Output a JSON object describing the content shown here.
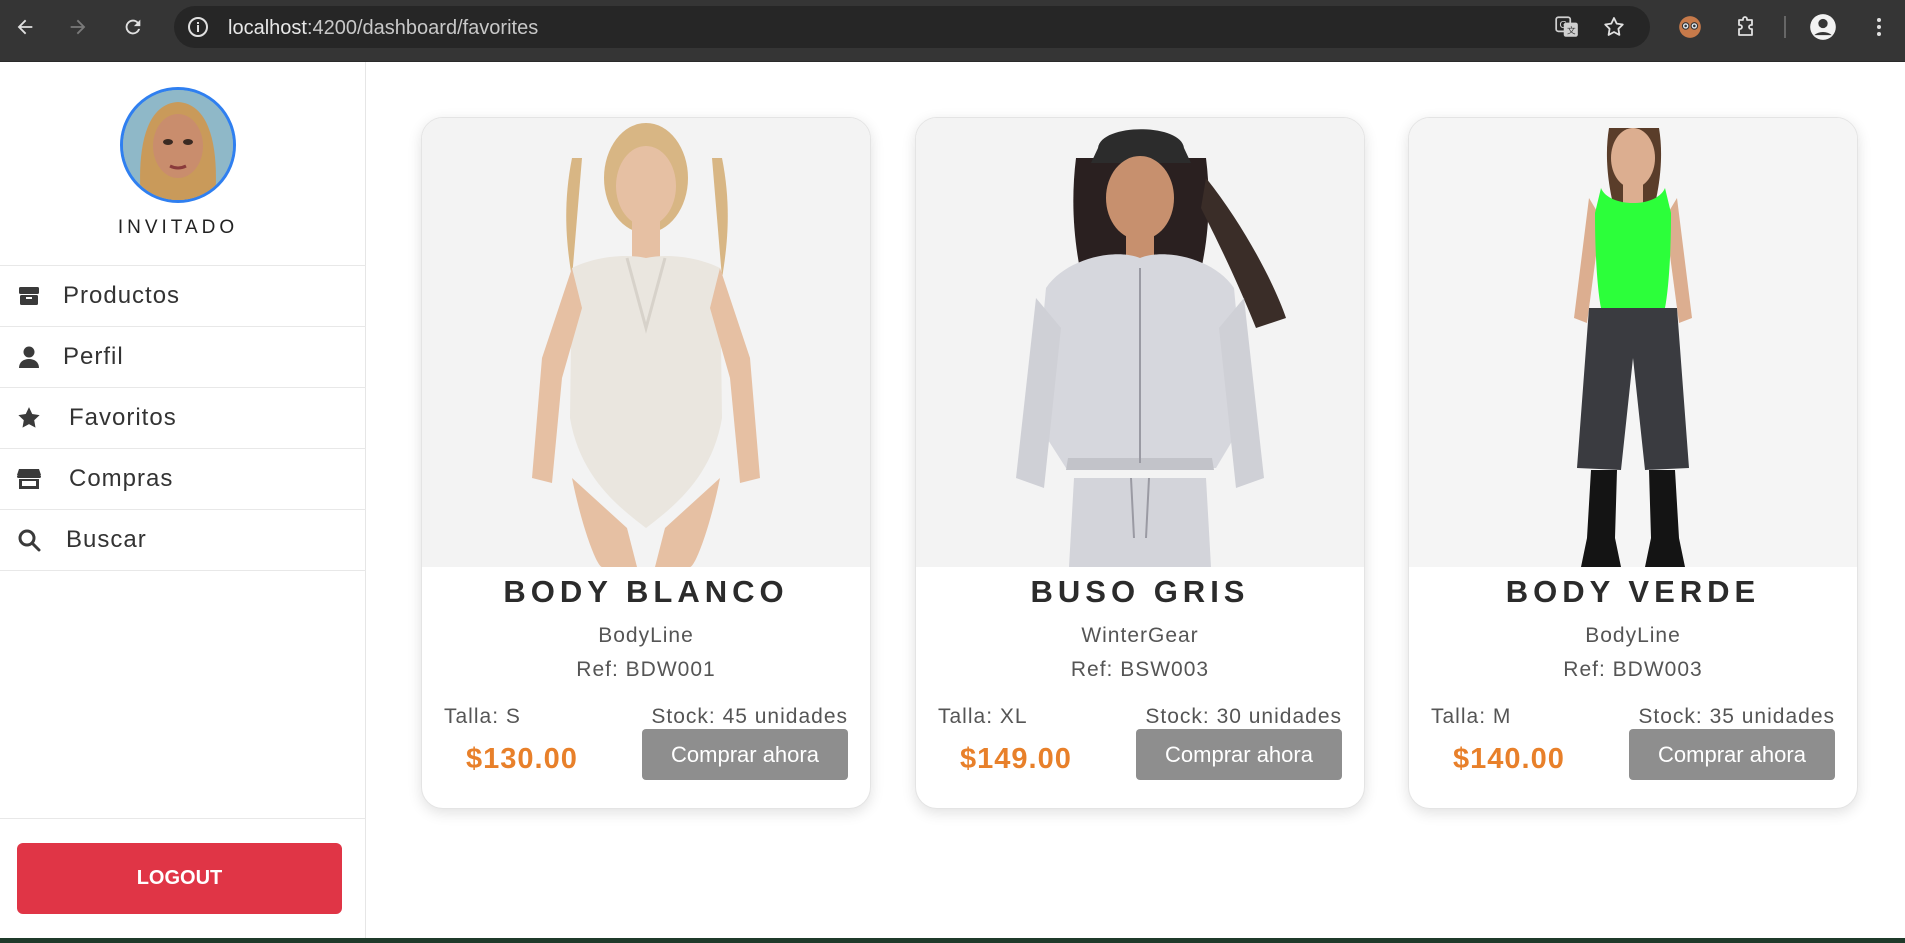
{
  "browser": {
    "url_host": "localhost",
    "url_path": ":4200/dashboard/favorites",
    "icons": [
      "back-arrow-icon",
      "forward-arrow-icon",
      "reload-icon",
      "site-info-icon",
      "translate-icon",
      "bookmark-star-icon",
      "extension-avatar-icon",
      "extensions-puzzle-icon",
      "profile-icon",
      "more-menu-icon"
    ]
  },
  "sidebar": {
    "username": "INVITADO",
    "items": [
      {
        "label": "Productos",
        "icon": "box-icon"
      },
      {
        "label": "Perfil",
        "icon": "user-icon"
      },
      {
        "label": "Favoritos",
        "icon": "star-icon"
      },
      {
        "label": "Compras",
        "icon": "store-icon"
      },
      {
        "label": "Buscar",
        "icon": "search-icon"
      }
    ],
    "logout_label": "LOGOUT"
  },
  "colors": {
    "accent_price": "#e8802a",
    "logout": "#e03546",
    "avatar_ring": "#2f7ff0",
    "buy_button": "#8e8e8e"
  },
  "products": [
    {
      "name": "BODY BLANCO",
      "brand": "BodyLine",
      "ref": "Ref: BDW001",
      "talla": "Talla: S",
      "stock": "Stock: 45 unidades",
      "price": "$130.00",
      "buy_label": "Comprar ahora"
    },
    {
      "name": "BUSO GRIS",
      "brand": "WinterGear",
      "ref": "Ref: BSW003",
      "talla": "Talla: XL",
      "stock": "Stock: 30 unidades",
      "price": "$149.00",
      "buy_label": "Comprar ahora"
    },
    {
      "name": "BODY VERDE",
      "brand": "BodyLine",
      "ref": "Ref: BDW003",
      "talla": "Talla: M",
      "stock": "Stock: 35 unidades",
      "price": "$140.00",
      "buy_label": "Comprar ahora"
    }
  ]
}
